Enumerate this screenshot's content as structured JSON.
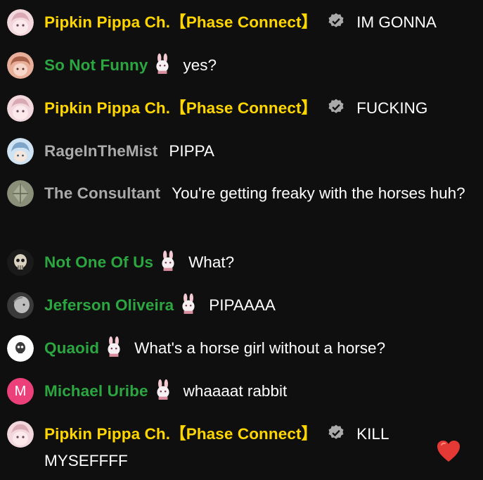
{
  "messages": [
    {
      "author": "Pipkin Pippa Ch.【Phase Connect】",
      "role": "owner",
      "badge": "verified-icon",
      "text": "IM GONNA",
      "avatar": "pippa-avatar",
      "avatar_color": "#f2d7dc"
    },
    {
      "author": "So Not Funny",
      "role": "member",
      "badge": "bunny-member-badge",
      "text": "yes?",
      "avatar": "anime-girl-avatar",
      "avatar_color": "#e8b09a"
    },
    {
      "author": "Pipkin Pippa Ch.【Phase Connect】",
      "role": "owner",
      "badge": "verified-icon",
      "text": "FUCKING",
      "avatar": "pippa-avatar",
      "avatar_color": "#f2d7dc"
    },
    {
      "author": "RageInTheMist",
      "role": "regular",
      "badge": "",
      "text": "PIPPA",
      "avatar": "anime-blue-avatar",
      "avatar_color": "#cfe3f3"
    },
    {
      "author": "The Consultant",
      "role": "regular",
      "badge": "",
      "text": "You're getting freaky with the horses huh?",
      "avatar": "rock-avatar",
      "avatar_color": "#8a8f7a"
    },
    {
      "author": "Not One Of Us",
      "role": "member",
      "badge": "bunny-member-badge",
      "text": "What?",
      "avatar": "skull-avatar",
      "avatar_color": "#d9d2c0"
    },
    {
      "author": "Jeferson Oliveira",
      "role": "member",
      "badge": "bunny-member-badge",
      "text": "PIPAAAA",
      "avatar": "grey-avatar",
      "avatar_color": "#bdbdbd"
    },
    {
      "author": "Quaoid",
      "role": "member",
      "badge": "bunny-member-badge",
      "text": "What's a horse girl without a horse?",
      "avatar": "skull-white-avatar",
      "avatar_color": "#ffffff"
    },
    {
      "author": "Michael Uribe",
      "role": "member",
      "badge": "bunny-member-badge",
      "text": "whaaaat rabbit",
      "avatar": "letter-avatar",
      "avatar_color": "#ec407a",
      "avatar_initial": "M"
    },
    {
      "author": "Pipkin Pippa Ch.【Phase Connect】",
      "role": "owner",
      "badge": "verified-icon",
      "text": "KILL MYSEFFFF",
      "avatar": "pippa-avatar",
      "avatar_color": "#f2d7dc"
    }
  ],
  "reaction": {
    "icon": "heart-icon",
    "color": "#e53935"
  },
  "colors": {
    "owner": "#ffd600",
    "member": "#2ba640",
    "regular": "#aaaaaa",
    "background": "#0f0f0f"
  }
}
